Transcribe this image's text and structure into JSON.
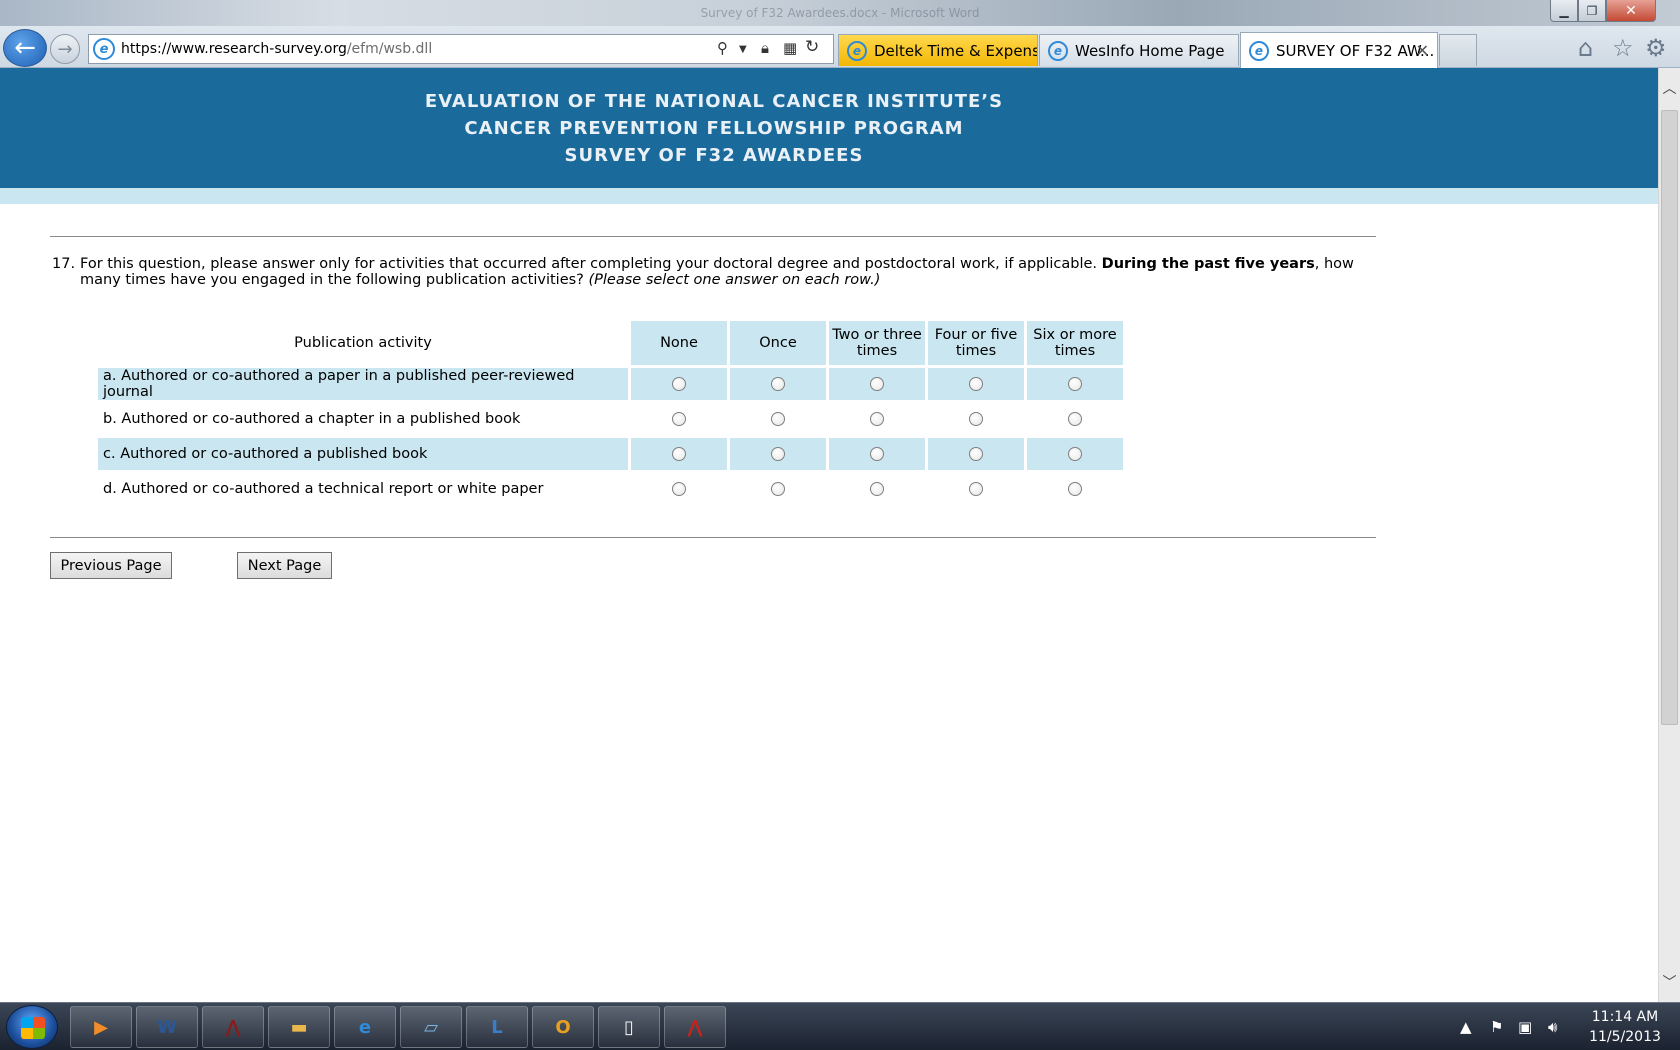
{
  "window": {
    "title": "Survey of F32 Awardees.docx - Microsoft Word"
  },
  "browser": {
    "address_url": "https://www.research-survey.org",
    "address_url_path": "/efm/wsb.dll",
    "tabs": [
      {
        "label": "Deltek Time & Expense..."
      },
      {
        "label": "WesInfo Home Page"
      },
      {
        "label": "SURVEY OF F32 AW..."
      }
    ]
  },
  "banner": {
    "line1": "EVALUATION OF THE NATIONAL CANCER INSTITUTE’S",
    "line2": "CANCER PREVENTION FELLOWSHIP PROGRAM",
    "line3": "SURVEY OF F32 AWARDEES"
  },
  "question": {
    "number": "17.",
    "text_before": "For this question, please answer only for activities that occurred after completing your doctoral degree and postdoctoral work, if applicable. ",
    "text_bold": "During the past five years",
    "text_after": ", how many times have you engaged in the following publication activities? ",
    "text_italic": "(Please select one answer on each row.)"
  },
  "grid": {
    "activity_header": "Publication activity",
    "options": [
      "None",
      "Once",
      "Two or three times",
      "Four or five times",
      "Six or more times"
    ],
    "rows": [
      {
        "label": "a. Authored or co-authored a paper in a published peer-reviewed journal"
      },
      {
        "label": "b. Authored or co-authored a chapter in a published book"
      },
      {
        "label": "c. Authored or co-authored a published book"
      },
      {
        "label": "d. Authored or co-authored a technical report or white paper"
      }
    ]
  },
  "buttons": {
    "previous": "Previous Page",
    "next": "Next Page"
  },
  "taskbar": {
    "time": "11:14 AM",
    "date": "11/5/2013",
    "apps": [
      "media-player",
      "word",
      "acrobat-reader",
      "file-explorer",
      "internet-explorer",
      "notepad",
      "lync",
      "outlook",
      "blank-document",
      "acrobat"
    ]
  },
  "colors": {
    "banner": "#1a6a9c",
    "shaded_row": "#c9e6f1"
  }
}
